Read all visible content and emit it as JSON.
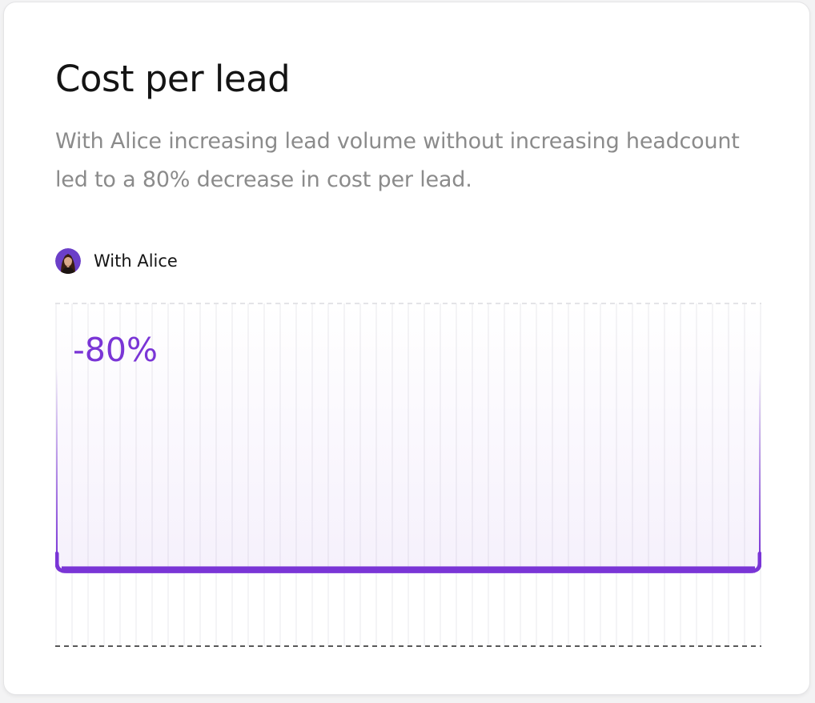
{
  "card": {
    "title": "Cost per lead",
    "description": "With Alice increasing lead volume without increasing headcount led to a 80% decrease in cost per lead."
  },
  "legend": {
    "label": "With Alice",
    "icon": "avatar"
  },
  "colors": {
    "accent": "#7a35d6",
    "title": "#141414",
    "description": "#8b8b8b",
    "gridline": "#e9e9ec"
  },
  "chart_data": {
    "type": "bar",
    "title": "",
    "categories": [
      "With Alice"
    ],
    "series": [
      {
        "name": "With Alice",
        "values": [
          -80
        ]
      }
    ],
    "data_labels": [
      "-80%"
    ],
    "ylim": [
      -100,
      0
    ],
    "grid": true,
    "legend": "top-left"
  }
}
